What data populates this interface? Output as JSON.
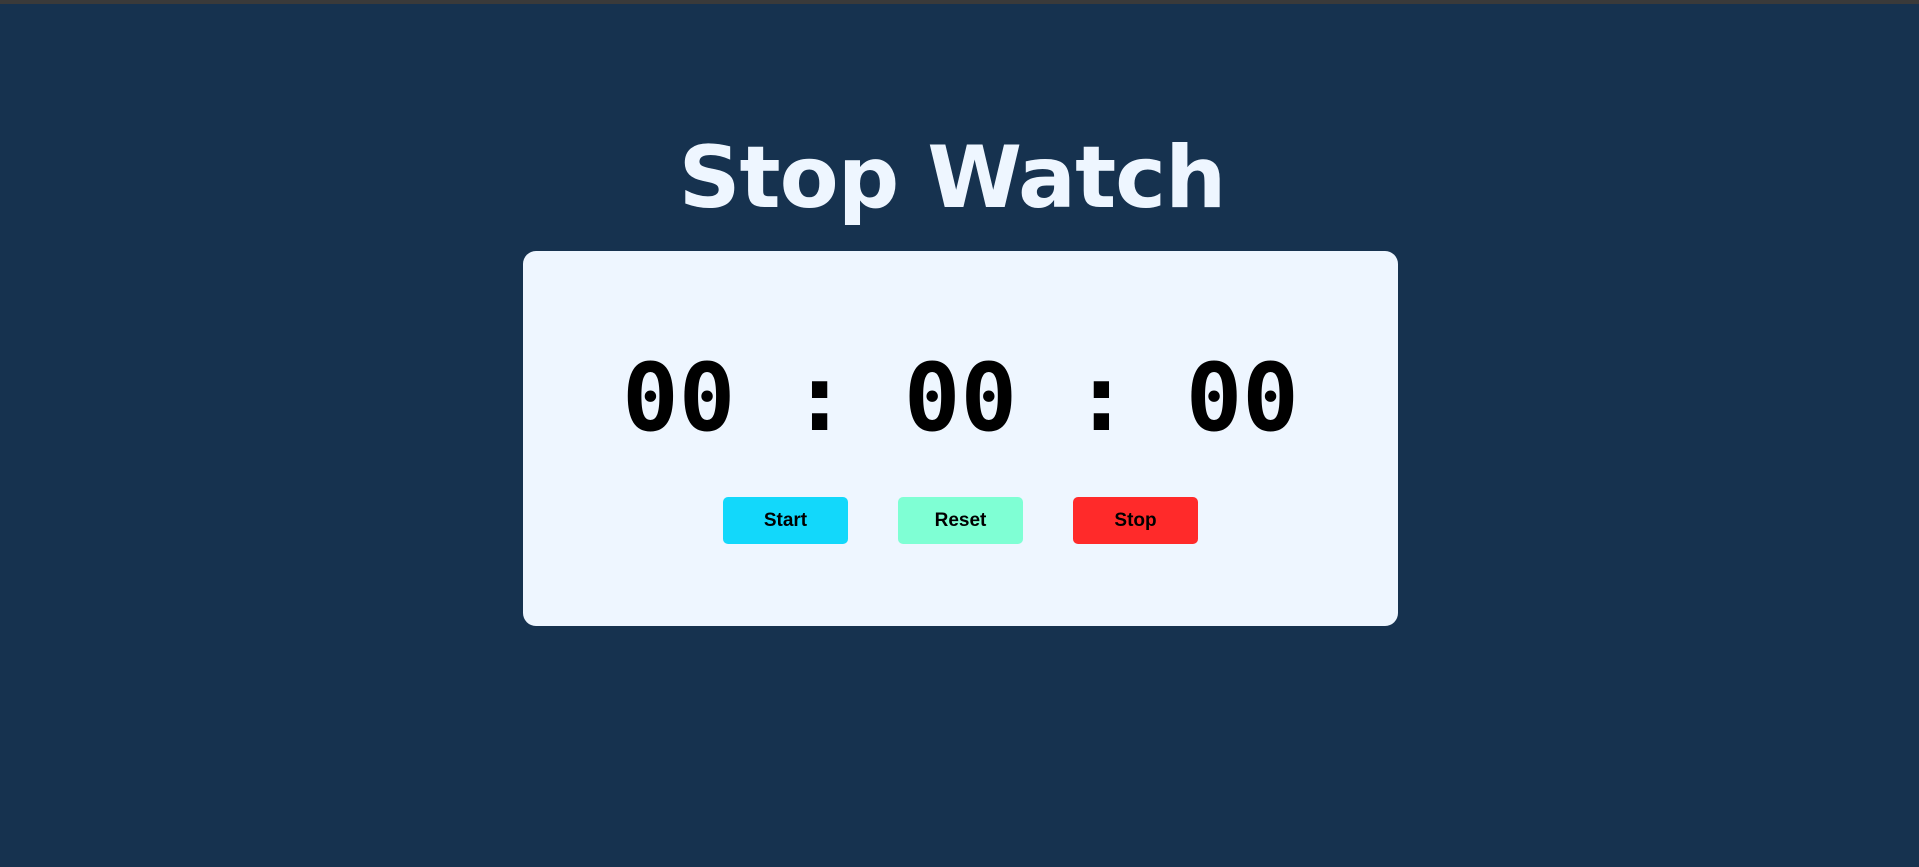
{
  "page": {
    "title": "Stop Watch"
  },
  "timer": {
    "hours": "00",
    "minutes": "00",
    "seconds": "00",
    "separator": ":"
  },
  "buttons": {
    "start_label": "Start",
    "reset_label": "Reset",
    "stop_label": "Stop"
  },
  "colors": {
    "background": "#16324f",
    "card": "#eef6ff",
    "title_text": "#eef6ff",
    "start_button": "#12d8fb",
    "reset_button": "#7fffd4",
    "stop_button": "#ff2a2a"
  }
}
